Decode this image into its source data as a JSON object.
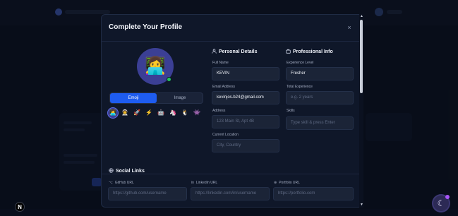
{
  "modal": {
    "title": "Complete Your Profile",
    "close_icon": "close-icon",
    "close_glyph": "×"
  },
  "avatar": {
    "emoji": "👩‍💻",
    "status_color": "#22c55e"
  },
  "avatar_mode": {
    "options": [
      "Emoji",
      "Image"
    ],
    "selected": "Emoji"
  },
  "emoji_options": [
    "👩‍💻",
    "👨‍🚀",
    "🚀",
    "⚡",
    "🤖",
    "🦄",
    "🐧",
    "👾"
  ],
  "personal": {
    "title": "Personal Details",
    "icon": "user-icon",
    "fields": {
      "full_name": {
        "label": "Full Name",
        "value": "KEVIN"
      },
      "email": {
        "label": "Email Address",
        "value": "kevinjos.b24@gmail.com"
      },
      "address": {
        "label": "Address",
        "placeholder": "123 Main St, Apt 4B"
      },
      "location": {
        "label": "Current Location",
        "placeholder": "City, Country"
      }
    }
  },
  "professional": {
    "title": "Professional Info",
    "icon": "briefcase-icon",
    "fields": {
      "experience_level": {
        "label": "Experience Level",
        "value": "Fresher"
      },
      "total_experience": {
        "label": "Total Experience",
        "placeholder": "e.g. 2 years"
      },
      "skills": {
        "label": "Skills",
        "placeholder": "Type skill & press Enter"
      }
    }
  },
  "social": {
    "title": "Social Links",
    "icon": "globe-icon",
    "links": [
      {
        "label": "GitHub URL",
        "placeholder": "https://github.com/username"
      },
      {
        "label": "LinkedIn URL",
        "placeholder": "https://linkedin.com/in/username"
      },
      {
        "label": "Portfolio URL",
        "placeholder": "https://portfolio.com"
      }
    ]
  },
  "corner": {
    "badge": "N"
  },
  "colors": {
    "accent": "#1e5cf0",
    "avatar_bg": "#3b3f95",
    "modal_bg": "#0f1729"
  }
}
